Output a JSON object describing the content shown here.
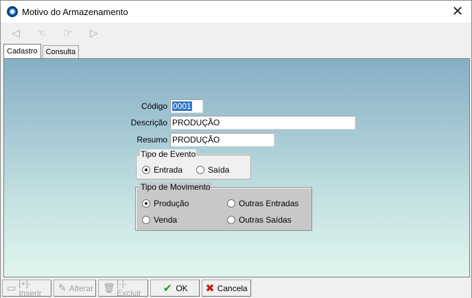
{
  "window": {
    "title": "Motivo do Armazenamento",
    "close_glyph": "✕"
  },
  "toolbar": {
    "icons": [
      "first-record-icon",
      "previous-record-icon",
      "next-record-icon",
      "last-record-icon"
    ],
    "glyphs": [
      "◁",
      "☜",
      "☞",
      "▷"
    ]
  },
  "tabs": [
    {
      "label": "Cadastro",
      "active": true
    },
    {
      "label": "Consulta",
      "active": false
    }
  ],
  "form": {
    "codigo": {
      "label": "Código",
      "value": "0001"
    },
    "descricao": {
      "label": "Descrição",
      "value": "PRODUÇÃO"
    },
    "resumo": {
      "label": "Resumo",
      "value": "PRODUÇÃO"
    },
    "tipo_evento": {
      "legend": "Tipo de Evento",
      "options": [
        {
          "label": "Entrada",
          "selected": true
        },
        {
          "label": "Saída",
          "selected": false
        }
      ]
    },
    "tipo_movimento": {
      "legend": "Tipo de Movimento",
      "options": [
        {
          "label": "Produção",
          "selected": true
        },
        {
          "label": "Outras Entradas",
          "selected": false
        },
        {
          "label": "Venda",
          "selected": false
        },
        {
          "label": "Outras Saídas",
          "selected": false
        }
      ]
    }
  },
  "bottom_bar": {
    "inserir": "[+]-Inserir",
    "alterar": "Alterar",
    "excluir": "[-]-Excluir",
    "ok": "OK",
    "cancela": "Cancela"
  },
  "colors": {
    "panel_top": "#86afc4",
    "panel_bottom": "#e2f5ee",
    "selection": "#3277c7"
  }
}
